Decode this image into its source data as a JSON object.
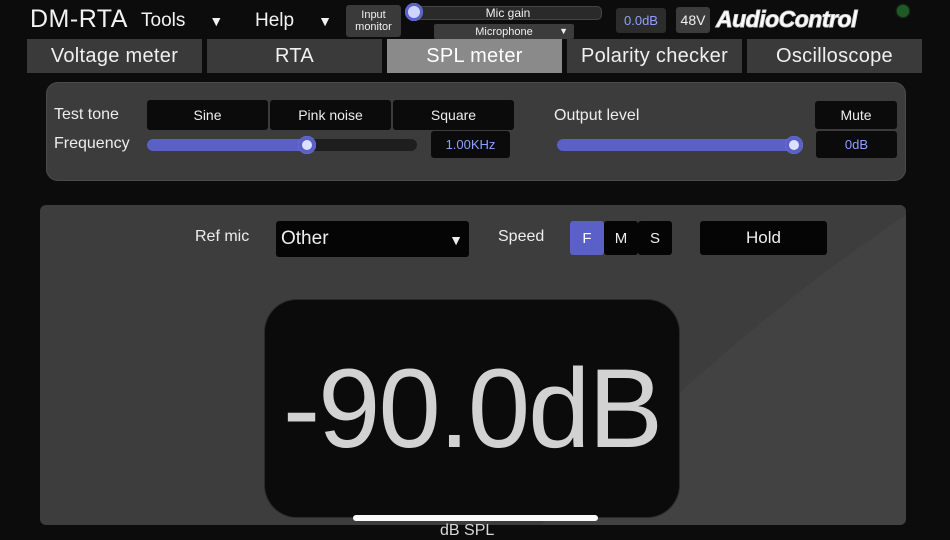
{
  "header": {
    "app_title": "DM-RTA",
    "menus": [
      {
        "label": "Tools",
        "caret": "▼"
      },
      {
        "label": "Help",
        "caret": "▼"
      }
    ],
    "input_monitor_line1": "Input",
    "input_monitor_line2": "monitor",
    "mic_gain_label": "Mic gain",
    "mic_source": "Microphone",
    "gain_value": "0.0dB",
    "phantom_power": "48V",
    "logo": "AudioControl",
    "accent_color": "#5a60c8",
    "value_text_color": "#8ea0ff"
  },
  "tabs": [
    {
      "label": "Voltage meter",
      "active": false
    },
    {
      "label": "RTA",
      "active": false
    },
    {
      "label": "SPL meter",
      "active": true
    },
    {
      "label": "Polarity checker",
      "active": false
    },
    {
      "label": "Oscilloscope",
      "active": false
    }
  ],
  "tone": {
    "test_tone_label": "Test tone",
    "buttons": [
      "Sine",
      "Pink noise",
      "Square"
    ],
    "frequency_label": "Frequency",
    "frequency_value": "1.00KHz",
    "output_level_label": "Output level",
    "mute_label": "Mute",
    "output_value": "0dB"
  },
  "spl": {
    "ref_mic_label": "Ref mic",
    "ref_mic_value": "Other",
    "speed_label": "Speed",
    "speed_options": [
      "F",
      "M",
      "S"
    ],
    "speed_selected": "F",
    "hold_label": "Hold",
    "reading": "-90.0dB",
    "unit_caption": "dB SPL"
  }
}
